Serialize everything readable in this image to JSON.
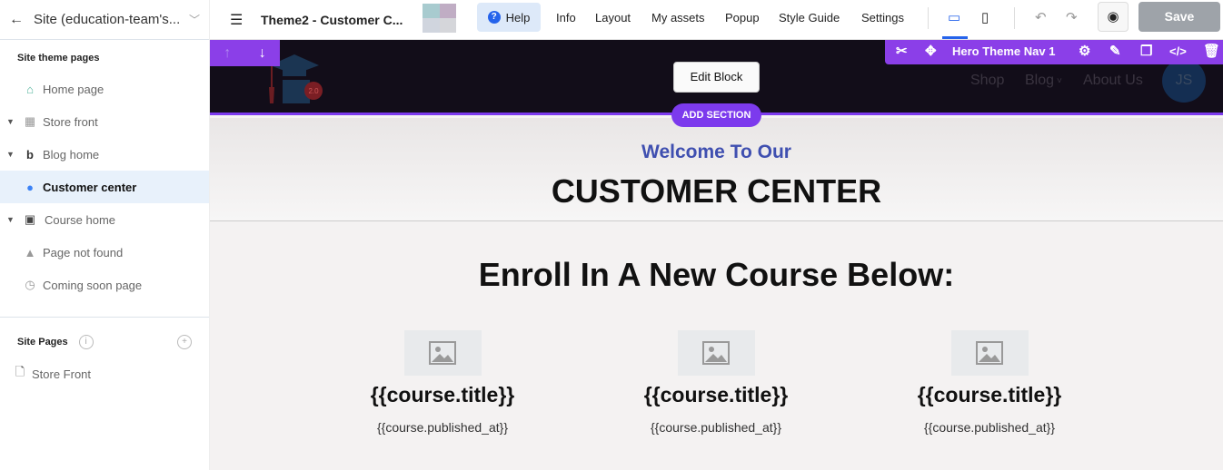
{
  "sidebar": {
    "site_selector": "Site (education-team's...",
    "theme_pages_title": "Site theme pages",
    "theme_pages": [
      {
        "label": "Home page",
        "icon": "home-icon",
        "expandable": false
      },
      {
        "label": "Store front",
        "icon": "store-icon",
        "expandable": true
      },
      {
        "label": "Blog home",
        "icon": "blog-icon",
        "expandable": true
      },
      {
        "label": "Customer center",
        "icon": "user-icon",
        "expandable": false,
        "active": true
      },
      {
        "label": "Course home",
        "icon": "course-icon",
        "expandable": true
      },
      {
        "label": "Page not found",
        "icon": "warning-icon",
        "expandable": false
      },
      {
        "label": "Coming soon page",
        "icon": "clock-icon",
        "expandable": false
      }
    ],
    "site_pages_title": "Site Pages",
    "site_pages": [
      {
        "label": "Store Front",
        "icon": "file-icon"
      }
    ]
  },
  "topbar": {
    "title": "Theme2 - Customer C...",
    "help": "Help",
    "nav": [
      "Info",
      "Layout",
      "My assets",
      "Popup",
      "Style Guide",
      "Settings"
    ],
    "save": "Save",
    "accent": "#2563eb"
  },
  "canvas": {
    "nav_links": [
      "Shop",
      "Blog",
      "About Us"
    ],
    "avatar": "JS",
    "logo_badge": "2.0",
    "block_name": "Hero Theme Nav 1",
    "edit_block": "Edit Block",
    "add_section": "ADD SECTION",
    "welcome": "Welcome To Our",
    "heading": "CUSTOMER CENTER",
    "enroll": "Enroll In A New Course Below:",
    "cards": [
      {
        "title": "{{course.title}}",
        "date": "{{course.published_at}}"
      },
      {
        "title": "{{course.title}}",
        "date": "{{course.published_at}}"
      },
      {
        "title": "{{course.title}}",
        "date": "{{course.published_at}}"
      }
    ],
    "accent": "#8b3fe8"
  }
}
